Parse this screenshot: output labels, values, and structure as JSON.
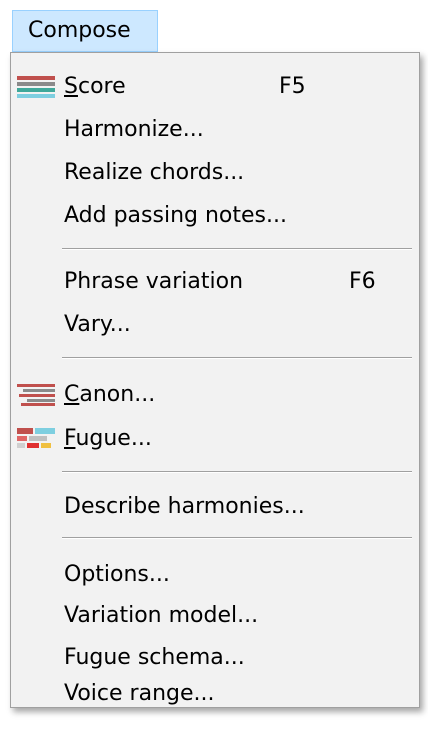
{
  "menubar": {
    "title": "Compose"
  },
  "menu": {
    "items": [
      {
        "label": "Score",
        "mnemonic": "S",
        "rest": "core",
        "accel": "F5",
        "icon": "score-icon"
      },
      {
        "label": "Harmonize..."
      },
      {
        "label": "Realize chords..."
      },
      {
        "label": "Add passing notes..."
      },
      {
        "label": "Phrase variation",
        "accel": "F6"
      },
      {
        "label": "Vary..."
      },
      {
        "label": "Canon...",
        "mnemonic": "C",
        "rest": "anon...",
        "icon": "canon-icon"
      },
      {
        "label": "Fugue...",
        "mnemonic": "F",
        "rest": "ugue...",
        "icon": "fugue-icon"
      },
      {
        "label": "Describe harmonies..."
      },
      {
        "label": "Options..."
      },
      {
        "label": "Variation model..."
      },
      {
        "label": "Fugue schema..."
      },
      {
        "label": "Voice range..."
      }
    ]
  },
  "colors": {
    "menu_background": "#f2f2f2",
    "menubar_highlight": "#cde8ff",
    "menubar_highlight_border": "#99d1ff",
    "separator": "#a0a0a0"
  }
}
